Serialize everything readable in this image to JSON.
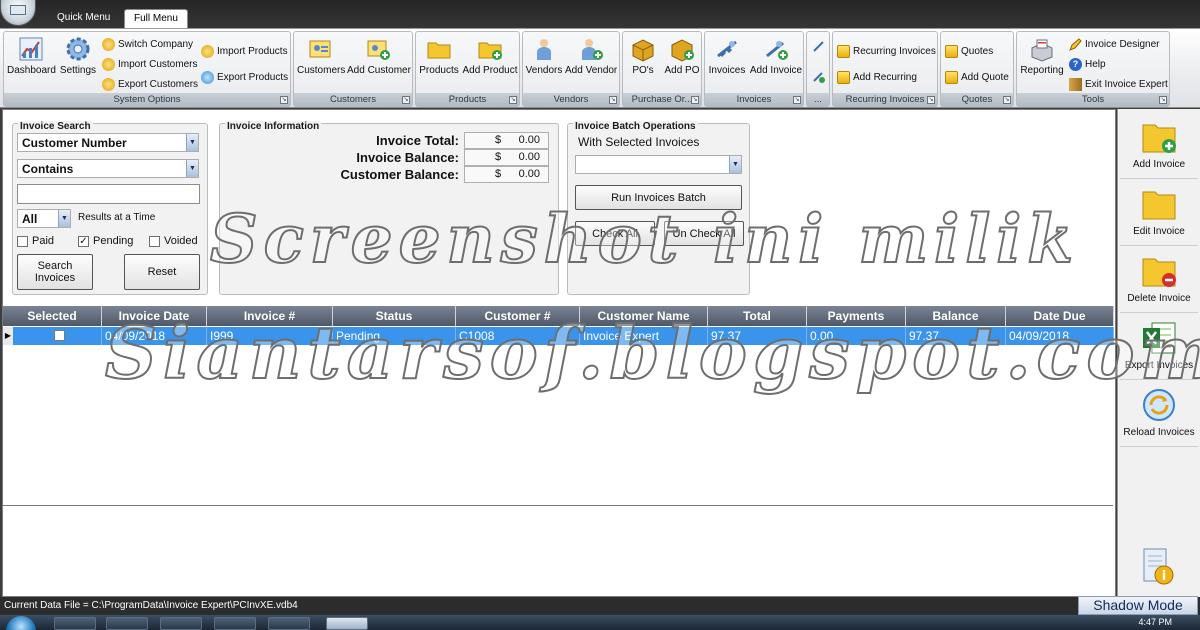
{
  "menu_tabs": [
    {
      "label": "Quick Menu"
    },
    {
      "label": "Full Menu"
    }
  ],
  "ribbon": {
    "system": {
      "title": "System Options",
      "dashboard": "Dashboard",
      "settings": "Settings",
      "switch_company": "Switch Company",
      "import_customers": "Import Customers",
      "export_customers": "Export Customers",
      "import_products": "Import Products",
      "export_products": "Export Products"
    },
    "customers": {
      "title": "Customers",
      "customers": "Customers",
      "add_customer": "Add Customer"
    },
    "products": {
      "title": "Products",
      "products": "Products",
      "add_product": "Add Product"
    },
    "vendors": {
      "title": "Vendors",
      "vendors": "Vendors",
      "add_vendor": "Add Vendor"
    },
    "purchase": {
      "title": "Purchase Or...",
      "pos": "PO's",
      "add_po": "Add PO"
    },
    "invoices": {
      "title": "Invoices",
      "invoices": "Invoices",
      "add_invoice": "Add Invoice"
    },
    "ellipsis": {
      "title": "..."
    },
    "recurring": {
      "title": "Recurring Invoices",
      "recurring_invoices": "Recurring Invoices",
      "add_recurring": "Add Recurring"
    },
    "quotes": {
      "title": "Quotes",
      "quotes": "Quotes",
      "add_quote": "Add Quote"
    },
    "tools": {
      "title": "Tools",
      "reporting": "Reporting",
      "invoice_designer": "Invoice Designer",
      "help": "Help",
      "exit": "Exit Invoice Expert"
    }
  },
  "search": {
    "title": "Invoice Search",
    "field": "Customer Number",
    "operator": "Contains",
    "value": "",
    "results_count": "All",
    "results_label": "Results at a Time",
    "paid": "Paid",
    "pending": "Pending",
    "voided": "Voided",
    "search_button": "Search Invoices",
    "reset_button": "Reset"
  },
  "info": {
    "title": "Invoice Information",
    "total_label": "Invoice Total:",
    "balance_label": "Invoice Balance:",
    "customer_balance_label": "Customer Balance:",
    "currency": "$",
    "total": "0.00",
    "balance": "0.00",
    "customer_balance": "0.00"
  },
  "batch": {
    "title": "Invoice Batch Operations",
    "with_selected": "With Selected Invoices",
    "selected_op": "",
    "run_button": "Run Invoices Batch",
    "check_all": "Check All",
    "uncheck_all": "Un Check All"
  },
  "grid": {
    "columns": [
      "Selected",
      "Invoice Date",
      "Invoice #",
      "Status",
      "Customer #",
      "Customer Name",
      "Total",
      "Payments",
      "Balance",
      "Date Due"
    ],
    "rows": [
      {
        "invoice_date": "04/09/2018",
        "invoice_no": "I999",
        "status": "Pending",
        "customer_no": "C1008",
        "customer_name": "Invoice Expert",
        "total": "97.37",
        "payments": "0.00",
        "balance": "97.37",
        "date_due": "04/09/2018"
      }
    ]
  },
  "sidebar": {
    "add_invoice": "Add Invoice",
    "edit_invoice": "Edit Invoice",
    "delete_invoice": "Delete Invoice",
    "export_invoices": "Export Invoices",
    "reload_invoices": "Reload Invoices"
  },
  "watermark": {
    "line1": "Screenshot ini milik",
    "line2": "Siantarsof.blogspot.com"
  },
  "status": {
    "data_file": "Current Data File = C:\\ProgramData\\Invoice Expert\\PCInvXE.vdb4",
    "shadow_mode": "Shadow Mode",
    "clock": "4:47 PM"
  },
  "colors": {
    "selection": "#3a94ec",
    "header": "#5c6575",
    "ribbon": "#e9ebee"
  }
}
